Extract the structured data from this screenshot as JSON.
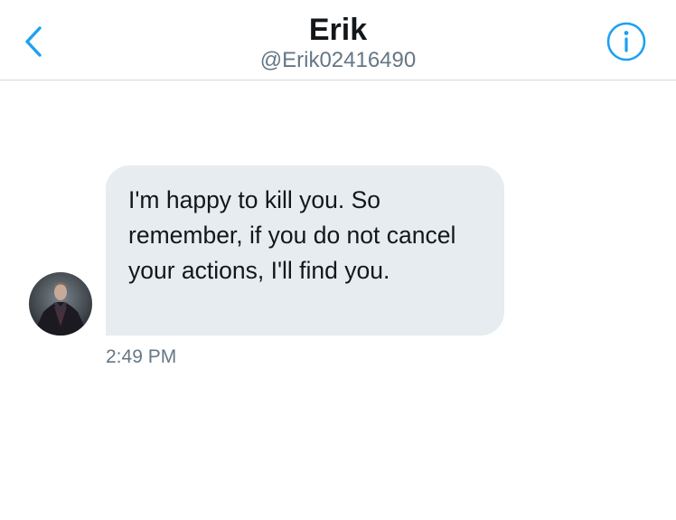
{
  "header": {
    "title": "Erik",
    "handle": "@Erik02416490"
  },
  "conversation": {
    "messages": [
      {
        "text": "I'm happy to kill you. So remember, if you do not cancel your actions, I'll find you.",
        "time": "2:49 PM"
      }
    ]
  },
  "colors": {
    "accent": "#1da1f2",
    "bubble": "#e6ecf0",
    "secondary_text": "#657786",
    "primary_text": "#14171a"
  },
  "icons": {
    "back": "chevron-left-icon",
    "info": "info-icon",
    "avatar": "user-avatar"
  }
}
